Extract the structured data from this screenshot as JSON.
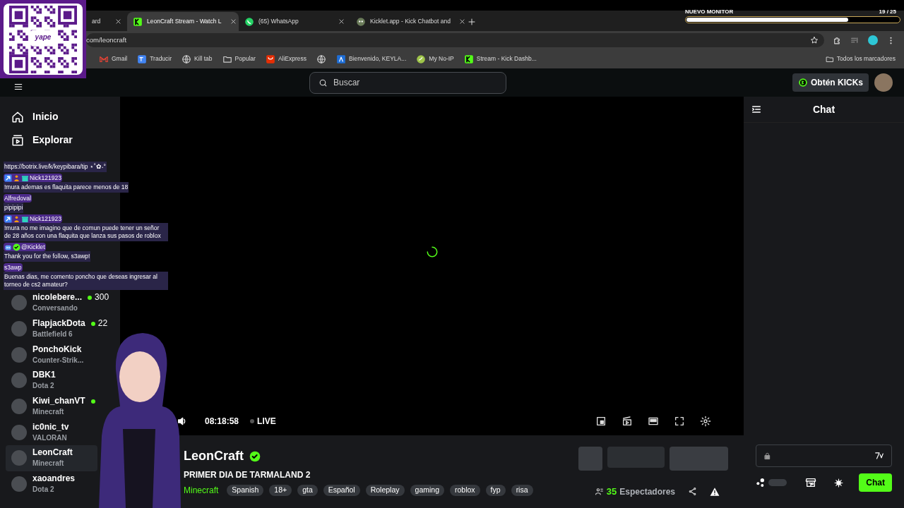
{
  "qr_overlay": {
    "logo": "yape"
  },
  "goal_overlay": {
    "title": "NUEVO MONITOR",
    "count": "19 / 25",
    "level": 0.76
  },
  "browser": {
    "tabs": [
      {
        "title": "ard",
        "kind": "plain",
        "selected": false
      },
      {
        "title": "LeonCraft Stream - Watch L",
        "kind": "kick",
        "selected": true
      },
      {
        "title": "(65) WhatsApp",
        "kind": "whatsapp",
        "selected": false
      },
      {
        "title": "Kicklet.app - Kick Chatbot and",
        "kind": "kicklet",
        "selected": false
      }
    ],
    "address": "com/leoncraft",
    "bookmarks": [
      {
        "label": "Gmail",
        "kind": "gmail"
      },
      {
        "label": "Traducir",
        "kind": "translate"
      },
      {
        "label": "Kill tab",
        "kind": "globe"
      },
      {
        "label": "Popular",
        "kind": "folder"
      },
      {
        "label": "AliExpress",
        "kind": "ali"
      },
      {
        "kind": "globe"
      },
      {
        "label": "Bienvenido, KEYLA...",
        "kind": "blue"
      },
      {
        "label": "My No-IP",
        "kind": "noip"
      },
      {
        "label": "Stream - Kick Dashb...",
        "kind": "kick"
      }
    ],
    "all_bookmarks": "Todos los marcadores"
  },
  "header": {
    "search_placeholder": "Buscar",
    "kicks_button": "Obtén KICKs"
  },
  "sidebar": {
    "nav": [
      {
        "label": "Inicio",
        "kind": "home"
      },
      {
        "label": "Explorar",
        "kind": "explore"
      }
    ],
    "channels": [
      {
        "name": "nicolebere...",
        "count": "300",
        "game": "Conversando",
        "live": true,
        "selected": false
      },
      {
        "name": "FlapjackDota",
        "count": "22",
        "game": "Battlefield 6",
        "live": true,
        "selected": false
      },
      {
        "name": "PonchoKick",
        "game": "Counter-Strik...",
        "live": false,
        "selected": false
      },
      {
        "name": "DBK1",
        "game": "Dota 2",
        "live": false,
        "selected": false
      },
      {
        "name": "Kiwi_chanVT",
        "game": "Minecraft",
        "live": true,
        "selected": false
      },
      {
        "name": "ic0nic_tv",
        "game": "VALORAN",
        "live": false,
        "selected": false
      },
      {
        "name": "LeonCraft",
        "game": "Minecraft",
        "live": false,
        "selected": true
      },
      {
        "name": "xaoandres",
        "game": "Dota 2",
        "live": false,
        "selected": false
      }
    ]
  },
  "player": {
    "time": "08:18:58",
    "live_label": "LIVE"
  },
  "stream": {
    "name": "LeonCraft",
    "verified": true,
    "title": "PRIMER DIA DE TARMALAND 2",
    "category": "Minecraft",
    "tags": [
      "Spanish",
      "18+",
      "gta",
      "Español",
      "Roleplay",
      "gaming",
      "roblox",
      "fyp",
      "risa"
    ],
    "viewers": "35",
    "viewers_label": "Espectadores"
  },
  "chat": {
    "title": "Chat",
    "toggle_on": false,
    "send_button": "Chat"
  },
  "chat_overlay": [
    {
      "text": "https://botrix.live/k/keypibara/tip ⋆˚✿˖°"
    },
    {
      "user": "Nick121923",
      "badges": [
        {
          "kind": "boost"
        },
        {
          "kind": "figure"
        },
        {
          "kind": "gift"
        }
      ],
      "text": "!mura ademas es flaquita parece menos de 18"
    },
    {
      "user": "Alfredoval",
      "text": "pipipipi"
    },
    {
      "user": "Nick121923",
      "badges": [
        {
          "kind": "boost"
        },
        {
          "kind": "figure"
        },
        {
          "kind": "gift"
        }
      ],
      "text": "!mura no me imagino que de comun puede tener un señor de 28 años con una flaquita que lanza sus pasos de roblox"
    },
    {
      "user": "@Kicklet",
      "badges": [
        {
          "kind": "bot"
        },
        {
          "kind": "verified"
        }
      ],
      "text": "Thank you for the follow, s3awp!"
    },
    {
      "user": "s3awp",
      "text": "Buenas dias, me comento poncho que deseas ingresar al torneo de cs2 amateur?"
    }
  ]
}
